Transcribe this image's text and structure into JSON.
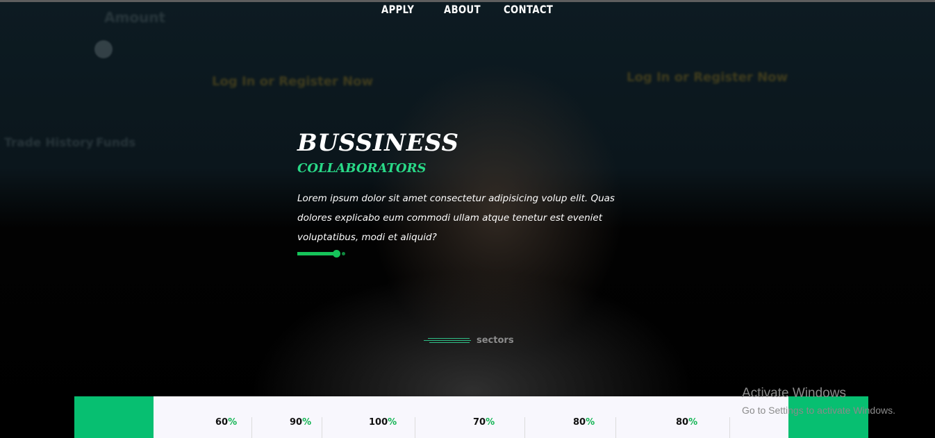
{
  "nav": {
    "items": [
      {
        "label": "APPLY"
      },
      {
        "label": "ABOUT"
      },
      {
        "label": "CONTACT"
      }
    ]
  },
  "hero": {
    "title": "BUSSINESS",
    "subtitle": "COLLABORATORS",
    "text": "Lorem ipsum dolor sit amet consectetur adipisicing volup elit. Quas dolores explicabo eum commodi ullam atque tenetur est eveniet voluptatibus, modi et aliquid?"
  },
  "background_text": {
    "amount": "Amount",
    "login_register_1": "Log In or Register Now",
    "login_register_2": "Log In or Register Now",
    "trade_history": "Trade History",
    "funds": "Funds"
  },
  "sectors": {
    "label": "sectors"
  },
  "stats": [
    {
      "value": "60",
      "suffix": "%"
    },
    {
      "value": "90",
      "suffix": "%"
    },
    {
      "value": "100",
      "suffix": "%"
    },
    {
      "value": "70",
      "suffix": "%"
    },
    {
      "value": "80",
      "suffix": "%"
    },
    {
      "value": "80",
      "suffix": "%"
    }
  ],
  "watermark": {
    "title": "Activate Windows",
    "subtitle": "Go to Settings to activate Windows."
  },
  "colors": {
    "accent_green": "#07bf71",
    "subtitle_green": "#29d987",
    "bar_green": "#16c45a"
  }
}
